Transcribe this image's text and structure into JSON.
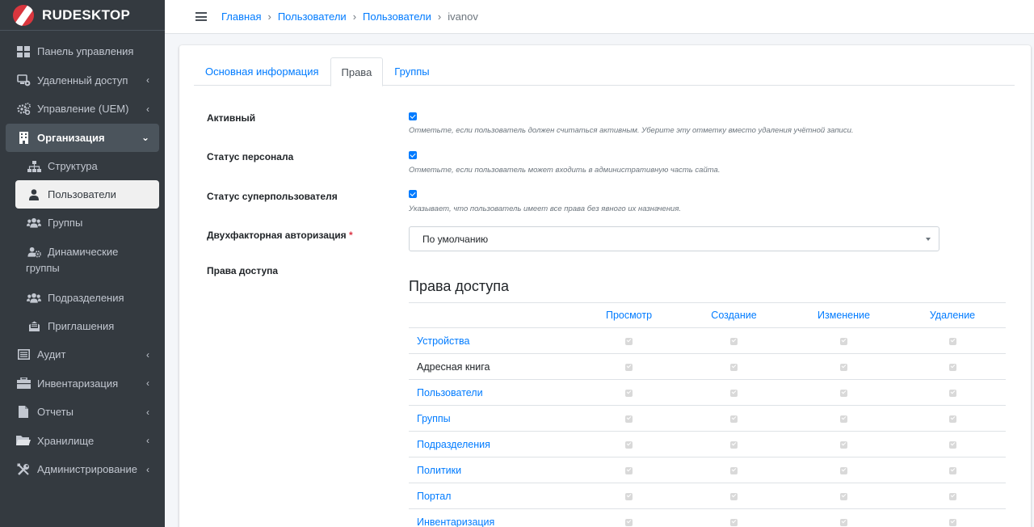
{
  "brand": {
    "name": "RUDESKTOP"
  },
  "sidebar": {
    "items": [
      {
        "label": "Панель управления",
        "icon": "dashboard-icon",
        "arrow": false
      },
      {
        "label": "Удаленный доступ",
        "icon": "remote-access-icon",
        "arrow": true
      },
      {
        "label": "Управление (UEM)",
        "icon": "cogs-icon",
        "arrow": true
      },
      {
        "label": "Организация",
        "icon": "building-icon",
        "arrow": true,
        "open": true
      },
      {
        "label": "Аудит",
        "icon": "list-icon",
        "arrow": true
      },
      {
        "label": "Инвентаризация",
        "icon": "inventory-icon",
        "arrow": true
      },
      {
        "label": "Отчеты",
        "icon": "file-icon",
        "arrow": true
      },
      {
        "label": "Хранилище",
        "icon": "folder-icon",
        "arrow": true
      },
      {
        "label": "Администрирование",
        "icon": "tools-icon",
        "arrow": true
      }
    ],
    "subitems": [
      {
        "label": "Структура",
        "icon": "sitemap-icon"
      },
      {
        "label": "Пользователи",
        "icon": "user-icon",
        "active": true
      },
      {
        "label": "Группы",
        "icon": "users-icon"
      },
      {
        "label_line1": "Динамические",
        "label_line2": "группы",
        "icon": "users-cog-icon"
      },
      {
        "label": "Подразделения",
        "icon": "users-icon"
      },
      {
        "label": "Приглашения",
        "icon": "envelope-icon"
      }
    ]
  },
  "breadcrumb": {
    "items": [
      "Главная",
      "Пользователи",
      "Пользователи"
    ],
    "current": "ivanov",
    "separator": "›"
  },
  "tabs": [
    "Основная информация",
    "Права",
    "Группы"
  ],
  "fields": {
    "active": {
      "label": "Активный",
      "checked": true,
      "help": "Отметьте, если пользователь должен считаться активным. Уберите эту отметку вместо удаления учётной записи."
    },
    "staff": {
      "label": "Статус персонала",
      "checked": true,
      "help": "Отметьте, если пользователь может входить в административную часть сайта."
    },
    "superuser": {
      "label": "Статус суперпользователя",
      "checked": true,
      "help": "Указывает, что пользователь имеет все права без явного их назначения."
    },
    "twofa": {
      "label": "Двухфакторная авторизация",
      "required_mark": "*",
      "value": "По умолчанию"
    },
    "perms": {
      "label": "Права доступа"
    }
  },
  "permissions": {
    "title": "Права доступа",
    "columns": [
      "Просмотр",
      "Создание",
      "Изменение",
      "Удаление"
    ],
    "rows": [
      {
        "name": "Устройства",
        "dark": false
      },
      {
        "name": "Адресная книга",
        "dark": true
      },
      {
        "name": "Пользователи",
        "dark": false
      },
      {
        "name": "Группы",
        "dark": false
      },
      {
        "name": "Подразделения",
        "dark": false
      },
      {
        "name": "Политики",
        "dark": false
      },
      {
        "name": "Портал",
        "dark": false
      },
      {
        "name": "Инвентаризация",
        "dark": false
      }
    ]
  },
  "colors": {
    "sidebar_bg": "#343a40",
    "accent": "#007bff",
    "brand_red": "#d9363e"
  }
}
